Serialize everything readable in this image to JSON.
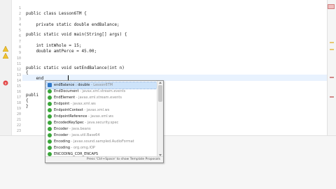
{
  "editor": {
    "line_numbers": [
      "1",
      "2",
      "3",
      "4",
      "5",
      "6",
      "7",
      "8",
      "9",
      "10",
      "11",
      "12",
      "13",
      "14",
      "15",
      "16",
      "17",
      "18",
      "19",
      "20",
      "21",
      "22",
      "23"
    ],
    "code_lines": [
      {
        "n": "1",
        "text": "public class Lesson6TM {"
      },
      {
        "n": "3",
        "text": "    private static double endBalance;"
      },
      {
        "n": "5",
        "text": "public static void main(String[] args) {"
      },
      {
        "n": "7",
        "text": "    int intWhole = 15;"
      },
      {
        "n": "8",
        "text": "    double amtPerce = 45.00;"
      },
      {
        "n": "12",
        "text": "public static void setEndBalance(int n)"
      },
      {
        "n": "13",
        "text": "{"
      },
      {
        "n": "14",
        "text": "    end"
      },
      {
        "n": "16",
        "text": "publi"
      },
      {
        "n": "17",
        "text": "{"
      },
      {
        "n": "18",
        "text": "}"
      }
    ]
  },
  "autocomplete": {
    "items": [
      {
        "name": "endBalance : double",
        "pkg": " - Lesson6TM",
        "icon": "field-icon"
      },
      {
        "name": "EndDocument",
        "pkg": " - javax.xml.stream.events",
        "icon": "class-icon"
      },
      {
        "name": "EndElement",
        "pkg": " - javax.xml.stream.events",
        "icon": "class-icon"
      },
      {
        "name": "Endpoint",
        "pkg": " - javax.xml.ws",
        "icon": "class-icon"
      },
      {
        "name": "EndpointContext",
        "pkg": " - javax.xml.ws",
        "icon": "class-icon"
      },
      {
        "name": "EndpointReference",
        "pkg": " - javax.xml.ws",
        "icon": "class-icon"
      },
      {
        "name": "EncodedKeySpec",
        "pkg": " - java.security.spec",
        "icon": "class-icon"
      },
      {
        "name": "Encoder",
        "pkg": " - java.beans",
        "icon": "class-icon"
      },
      {
        "name": "Encoder",
        "pkg": " - java.util.Base64",
        "icon": "class-icon"
      },
      {
        "name": "Encoding",
        "pkg": " - javax.sound.sampled.AudioFormat",
        "icon": "class-icon"
      },
      {
        "name": "Encoding",
        "pkg": " - org.omg.IOP",
        "icon": "class-icon"
      },
      {
        "name": "ENCODING_CDR_ENCAPS",
        "pkg": "",
        "icon": "class-icon"
      }
    ],
    "footer": "Press 'Ctrl+Space' to show Template Proposals"
  }
}
